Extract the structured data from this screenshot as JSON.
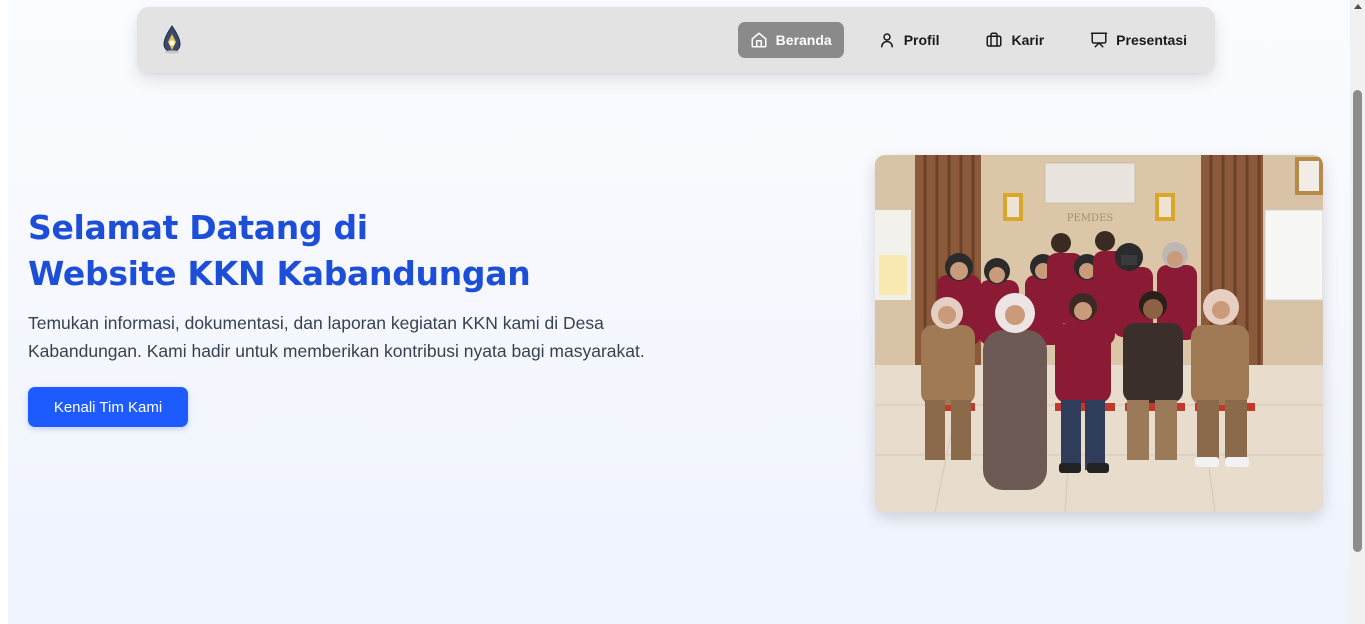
{
  "nav": {
    "logo_icon": "drop-shield-logo",
    "items": [
      {
        "label": "Beranda",
        "icon": "home-icon",
        "active": true
      },
      {
        "label": "Profil",
        "icon": "user-icon",
        "active": false
      },
      {
        "label": "Karir",
        "icon": "briefcase-icon",
        "active": false
      },
      {
        "label": "Presentasi",
        "icon": "presentation-icon",
        "active": false
      }
    ]
  },
  "hero": {
    "title_line1": "Selamat Datang di",
    "title_line2": "Website KKN Kabandungan",
    "description": "Temukan informasi, dokumentasi, dan laporan kegiatan KKN kami di Desa Kabandungan. Kami hadir untuk memberikan kontribusi nyata bagi masyarakat.",
    "cta_label": "Kenali Tim Kami",
    "photo_sign": "PEMDES"
  },
  "colors": {
    "accent": "#1d4ed8",
    "button": "#1e5bff",
    "nav_bg": "#e3e3e3",
    "nav_active": "#8a8a8a"
  }
}
